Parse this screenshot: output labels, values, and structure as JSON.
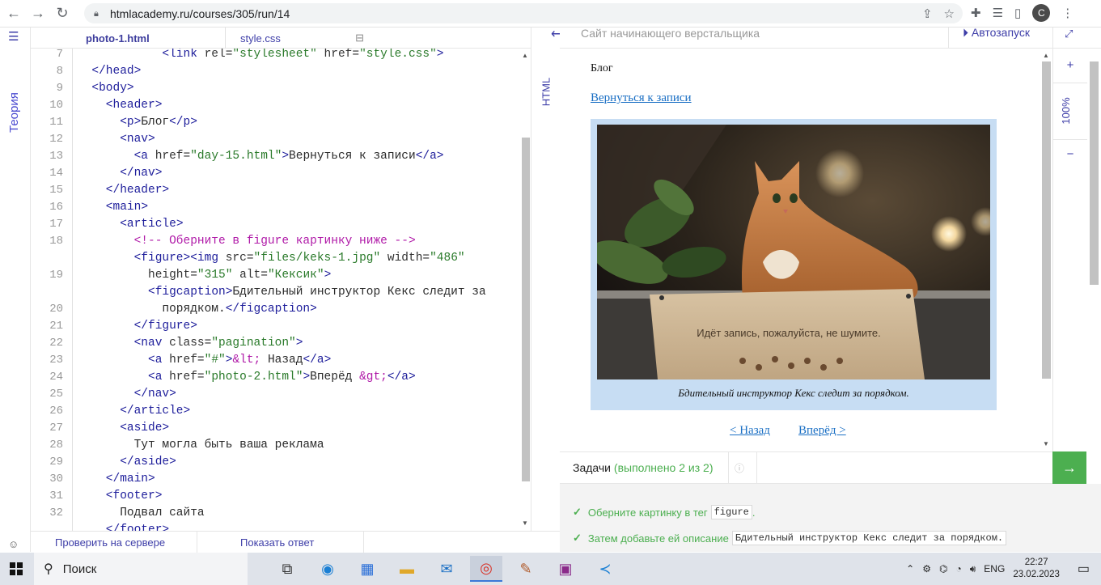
{
  "browser": {
    "url": "htmlacademy.ru/courses/305/run/14",
    "profile_initial": "C"
  },
  "left_rail": {
    "theory_label": "Теория"
  },
  "editor": {
    "tabs": [
      {
        "label": "photo-1.html"
      },
      {
        "label": "style.css"
      }
    ],
    "line_numbers": [
      "7",
      "8",
      "9",
      "10",
      "11",
      "12",
      "13",
      "14",
      "15",
      "16",
      "17",
      "18",
      "",
      "19",
      "",
      "20",
      "21",
      "22",
      "23",
      "24",
      "25",
      "26",
      "27",
      "28",
      "29",
      "30",
      "31",
      "32"
    ],
    "lines": [
      "<link rel=\"stylesheet\" href=\"style.css\">",
      "</head>",
      "<body>",
      "<header>",
      "<p>Блог</p>",
      "<nav>",
      "<a href=\"day-15.html\">Вернуться к записи</a>",
      "</nav>",
      "</header>",
      "<main>",
      "<article>",
      "<!-- Оберните в figure картинку ниже -->",
      "<figure><img src=\"files/keks-1.jpg\" width=\"486\"",
      "height=\"315\" alt=\"Кексик\">",
      "<figcaption>Бдительный инструктор Кекс следит за",
      "порядком.</figcaption>",
      "</figure>",
      "<nav class=\"pagination\">",
      "<a href=\"#\">&lt; Назад</a>",
      "<a href=\"photo-2.html\">Вперёд &gt;</a>",
      "</nav>",
      "</article>",
      "<aside>",
      "Тут могла быть ваша реклама",
      "</aside>",
      "</main>",
      "<footer>",
      "Подвал сайта",
      "</footer>"
    ]
  },
  "bottom_bar": {
    "check_label": "Проверить на сервере",
    "answer_label": "Показать ответ"
  },
  "html_tab_label": "HTML",
  "preview": {
    "header_title": "Сайт начинающего верстальщика",
    "autorun_label": "Автозапуск",
    "blog": "Блог",
    "back_link": "Вернуться к записи",
    "photo_sign": "Идёт запись, пожалуйста, не шумите.",
    "caption": "Бдительный инструктор Кекс следит за порядком.",
    "prev": "< Назад",
    "next": "Вперёд >",
    "zoom": "100%"
  },
  "tasks": {
    "title": "Задачи",
    "done": "(выполнено 2 из 2)",
    "items": [
      {
        "text": "Оберните картинку в тег",
        "code": "figure",
        "tail": "."
      },
      {
        "text": "Затем добавьте ей описание",
        "code": "Бдительный инструктор Кекс следит за порядком.",
        "tail": ""
      }
    ]
  },
  "taskbar": {
    "search_label": "Поиск",
    "lang": "ENG",
    "time": "22:27",
    "date": "23.02.2023"
  }
}
